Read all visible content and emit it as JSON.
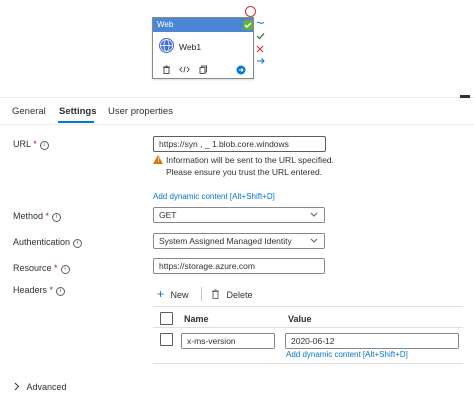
{
  "card": {
    "title": "Web",
    "name": "Web1",
    "footer_icons": [
      "delete-icon",
      "code-icon",
      "copy-icon",
      "arrow-forward-icon"
    ],
    "side_markers": [
      "~",
      "✓",
      "✕",
      "→"
    ]
  },
  "tabs": [
    {
      "label": "General"
    },
    {
      "label": "Settings"
    },
    {
      "label": "User properties"
    }
  ],
  "fields": {
    "url": {
      "label": "URL",
      "required": "*",
      "value": "https://syn  ,          _  1.blob.core.windows"
    },
    "warning": "Information will be sent to the URL specified. Please ensure you trust the URL entered.",
    "dynamic_link": "Add dynamic content [Alt+Shift+D]",
    "method": {
      "label": "Method",
      "required": "*",
      "value": "GET"
    },
    "authentication": {
      "label": "Authentication",
      "value": "System Assigned Managed Identity"
    },
    "resource": {
      "label": "Resource",
      "required": "*",
      "value": "https://storage.azure.com"
    },
    "headers": {
      "label": "Headers",
      "required": "*"
    }
  },
  "headers_table": {
    "new_label": "New",
    "delete_label": "Delete",
    "col_name": "Name",
    "col_value": "Value",
    "rows": [
      {
        "name": "x-ms-version",
        "value": "2020-06-12"
      }
    ],
    "row_dynamic_link": "Add dynamic content [Alt+Shift+D]"
  },
  "advanced_label": "Advanced",
  "colors": {
    "accent": "#0078d4",
    "header_blue": "#4a86d6",
    "success": "#5fb043",
    "warning": "#d17a00",
    "required": "#a4262c"
  }
}
